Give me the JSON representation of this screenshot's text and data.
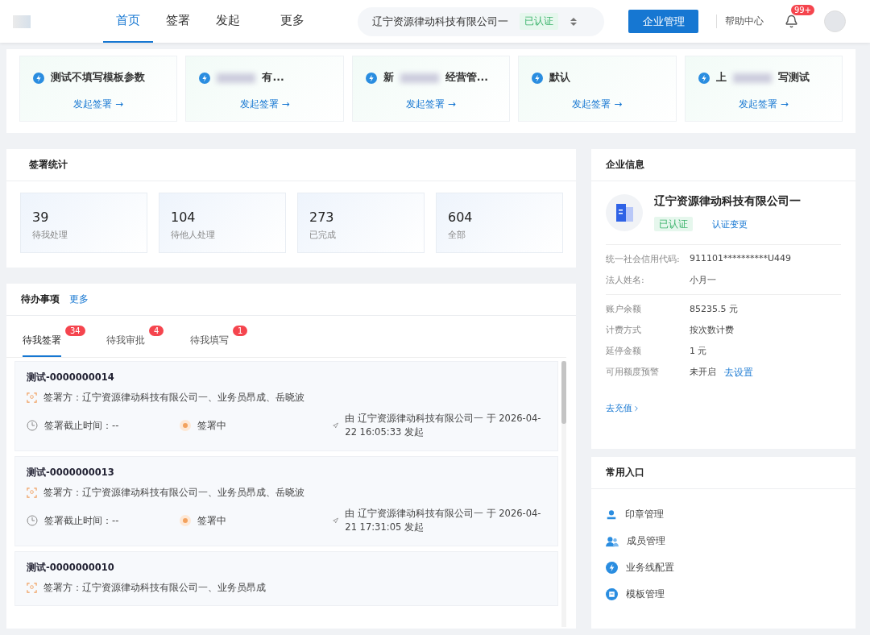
{
  "header": {
    "nav": [
      {
        "label": "首页",
        "selected": true
      },
      {
        "label": "签署",
        "selected": false
      },
      {
        "label": "发起",
        "selected": false
      },
      {
        "label": "更多",
        "selected": false
      }
    ],
    "company": {
      "name": "辽宁资源律动科技有限公司一",
      "badge": "已认证"
    },
    "manage_button": "企业管理",
    "help": "帮助中心",
    "notifications": "99+"
  },
  "templates": [
    {
      "title_start": "测试不填写模板参数",
      "blurred": false,
      "action": "发起签署 →"
    },
    {
      "title_end": "有...",
      "blurred": true,
      "action": "发起签署 →"
    },
    {
      "title_start": "新",
      "title_end": "经营管...",
      "blurred": true,
      "action": "发起签署 →"
    },
    {
      "title_start": "默认",
      "blurred": false,
      "action": "发起签署 →"
    },
    {
      "title_start": "上",
      "title_end": "写测试",
      "blurred": true,
      "action": "发起签署 →"
    }
  ],
  "stats": {
    "title": "签署统计",
    "items": [
      {
        "value": "39",
        "label": "待我处理"
      },
      {
        "value": "104",
        "label": "待他人处理"
      },
      {
        "value": "273",
        "label": "已完成"
      },
      {
        "value": "604",
        "label": "全部"
      }
    ]
  },
  "todo": {
    "title": "待办事项",
    "more": "更多",
    "tabs": [
      {
        "label": "待我签署",
        "count": "34",
        "selected": true
      },
      {
        "label": "待我审批",
        "count": "4",
        "selected": false
      },
      {
        "label": "待我填写",
        "count": "1",
        "selected": false
      }
    ],
    "items": [
      {
        "title": "测试-0000000014",
        "parties": "签署方：辽宁资源律动科技有限公司一、业务员昂成、岳晓波",
        "deadline": "签署截止时间：--",
        "status": "签署中",
        "initiator": "由 辽宁资源律动科技有限公司一 于 2026-04-22 16:05:33 发起"
      },
      {
        "title": "测试-0000000013",
        "parties": "签署方：辽宁资源律动科技有限公司一、业务员昂成、岳晓波",
        "deadline": "签署截止时间：--",
        "status": "签署中",
        "initiator": "由 辽宁资源律动科技有限公司一 于 2026-04-21 17:31:05 发起"
      },
      {
        "title": "测试-0000000010",
        "parties": "签署方：辽宁资源律动科技有限公司一、业务员昂成"
      }
    ]
  },
  "company_info": {
    "title": "企业信息",
    "name": "辽宁资源律动科技有限公司一",
    "badge": "已认证",
    "change": "认证变更",
    "identity": [
      {
        "label": "统一社会信用代码:",
        "value": "911101**********U449"
      },
      {
        "label": "法人姓名:",
        "value": "小月一"
      }
    ],
    "account": [
      {
        "label": "账户余额",
        "value": "85235.5 元"
      },
      {
        "label": "计费方式",
        "value": "按次数计费"
      },
      {
        "label": "延停金额",
        "value": "1 元"
      },
      {
        "label": "可用额度预警",
        "value": "未开启",
        "link": "去设置"
      }
    ],
    "recharge": "去充值"
  },
  "shortcuts": {
    "title": "常用入口",
    "items": [
      {
        "label": "印章管理",
        "kind": "seal"
      },
      {
        "label": "成员管理",
        "kind": "members"
      },
      {
        "label": "业务线配置",
        "kind": "bolt"
      },
      {
        "label": "模板管理",
        "kind": "template"
      }
    ]
  }
}
